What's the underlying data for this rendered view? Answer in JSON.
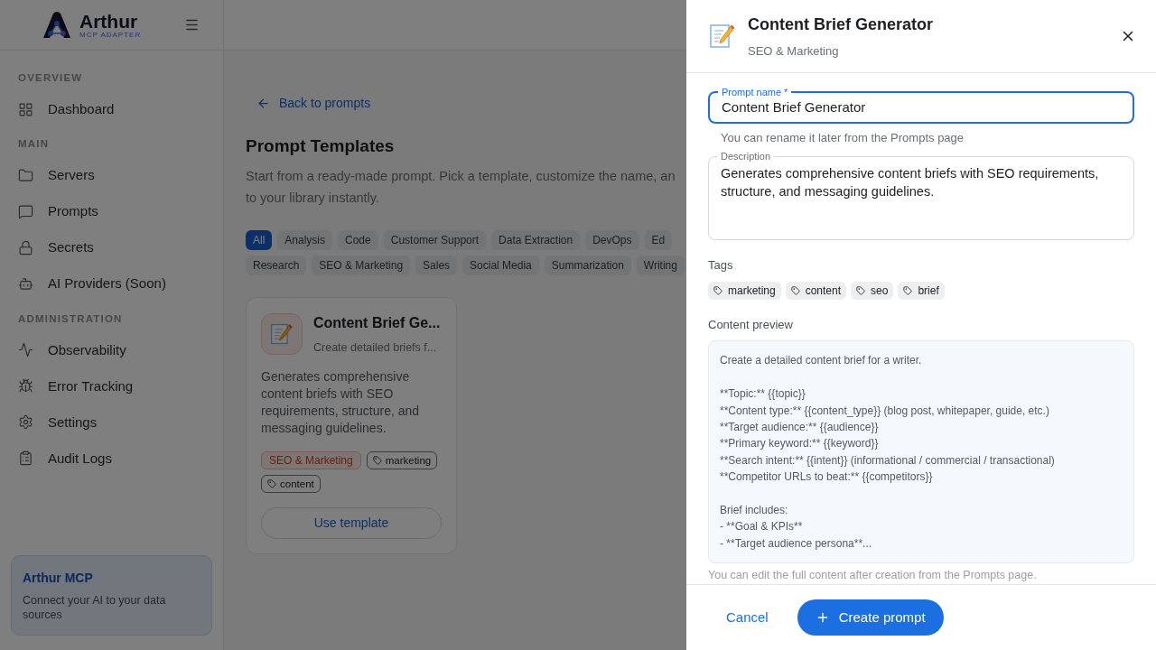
{
  "sidebar": {
    "brand": {
      "name": "Arthur",
      "subtitle": "MCP ADAPTER"
    },
    "sections": [
      {
        "title": "OVERVIEW",
        "items": [
          {
            "label": "Dashboard"
          }
        ]
      },
      {
        "title": "MAIN",
        "items": [
          {
            "label": "Servers"
          },
          {
            "label": "Prompts"
          },
          {
            "label": "Secrets"
          },
          {
            "label": "AI Providers (Soon)"
          }
        ]
      },
      {
        "title": "ADMINISTRATION",
        "items": [
          {
            "label": "Observability"
          },
          {
            "label": "Error Tracking"
          },
          {
            "label": "Settings"
          },
          {
            "label": "Audit Logs"
          }
        ]
      }
    ],
    "promo": {
      "title": "Arthur MCP",
      "text": "Connect your AI to your data sources"
    }
  },
  "main": {
    "back_link": "Back to prompts",
    "title": "Prompt Templates",
    "description_lines": [
      "Start from a ready-made prompt. Pick a template, customize the name, an",
      "to your library instantly."
    ],
    "filter_rows": [
      [
        {
          "label": "All",
          "selected": true
        },
        {
          "label": "Analysis",
          "selected": false
        },
        {
          "label": "Code",
          "selected": false
        },
        {
          "label": "Customer Support",
          "selected": false
        },
        {
          "label": "Data Extraction",
          "selected": false
        },
        {
          "label": "DevOps",
          "selected": false
        },
        {
          "label": "Ed",
          "selected": false
        }
      ],
      [
        {
          "label": "Research",
          "selected": false
        },
        {
          "label": "SEO & Marketing",
          "selected": false
        },
        {
          "label": "Sales",
          "selected": false
        },
        {
          "label": "Social Media",
          "selected": false
        },
        {
          "label": "Summarization",
          "selected": false
        },
        {
          "label": "Writing",
          "selected": false
        }
      ]
    ],
    "card": {
      "title": "Content Brief Ge...",
      "subtitle": "Create detailed briefs f...",
      "description": "Generates comprehensive content briefs with SEO requirements, structure, and messaging guidelines.",
      "category": "SEO & Marketing",
      "tags": [
        "marketing",
        "content"
      ],
      "button": "Use template"
    }
  },
  "drawer": {
    "title": "Content Brief Generator",
    "subtitle": "SEO & Marketing",
    "name_field": {
      "label": "Prompt name *",
      "value": "Content Brief Generator",
      "hint": "You can rename it later from the Prompts page",
      "focused": true
    },
    "description_field": {
      "label": "Description",
      "value": "Generates comprehensive content briefs with SEO requirements, structure, and messaging guidelines."
    },
    "tags_label": "Tags",
    "tags": [
      "marketing",
      "content",
      "seo",
      "brief"
    ],
    "preview_label": "Content preview",
    "preview": "Create a detailed content brief for a writer.\n\n**Topic:** {{topic}}\n**Content type:** {{content_type}} (blog post, whitepaper, guide, etc.)\n**Target audience:** {{audience}}\n**Primary keyword:** {{keyword}}\n**Search intent:** {{intent}} (informational / commercial / transactional)\n**Competitor URLs to beat:** {{competitors}}\n\nBrief includes:\n- **Goal & KPIs**\n- **Target audience persona**...",
    "preview_note": "You can edit the full content after creation from the Prompts page.",
    "cancel": "Cancel",
    "create": "Create prompt"
  }
}
